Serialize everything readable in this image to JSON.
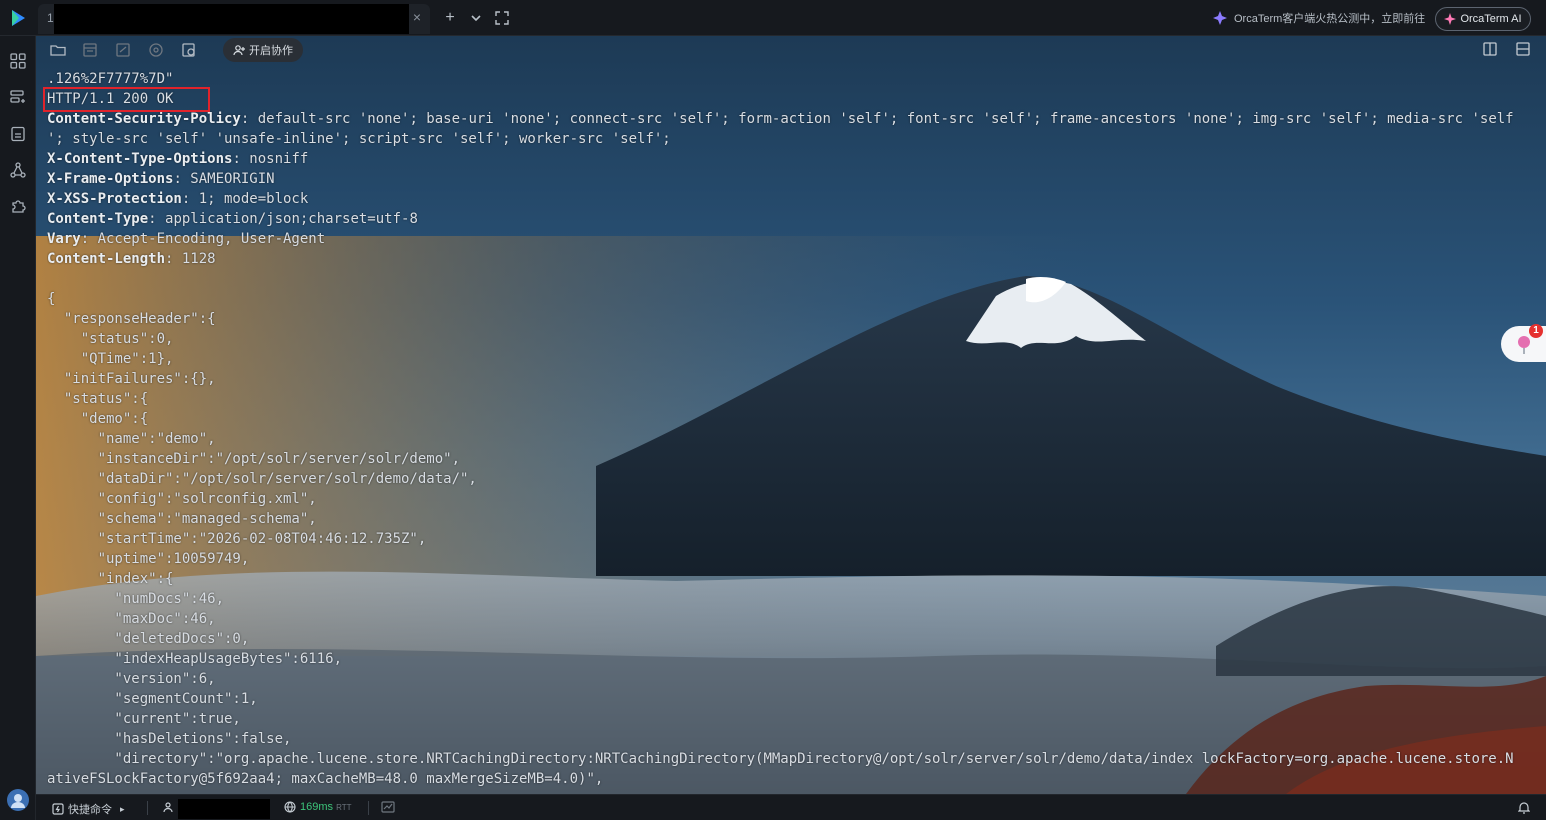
{
  "tabbar": {
    "tab_index": "1",
    "tab_close": "×",
    "new_tab": "+",
    "dropdown": "⌄",
    "fullscreen": "⛶",
    "promo_text": "OrcaTerm客户端火热公测中，立即前往",
    "ai_button": "OrcaTerm AI"
  },
  "toolbar": {
    "collab_label": "开启协作"
  },
  "terminal_lines": [
    ".126%2F7777%7D\"",
    "HTTP/1.1 200 OK",
    "Content-Security-Policy: default-src 'none'; base-uri 'none'; connect-src 'self'; form-action 'self'; font-src 'self'; frame-ancestors 'none'; img-src 'self'; media-src 'self",
    "'; style-src 'self' 'unsafe-inline'; script-src 'self'; worker-src 'self';",
    "X-Content-Type-Options: nosniff",
    "X-Frame-Options: SAMEORIGIN",
    "X-XSS-Protection: 1; mode=block",
    "Content-Type: application/json;charset=utf-8",
    "Vary: Accept-Encoding, User-Agent",
    "Content-Length: 1128",
    "",
    "{",
    "  \"responseHeader\":{",
    "    \"status\":0,",
    "    \"QTime\":1},",
    "  \"initFailures\":{},",
    "  \"status\":{",
    "    \"demo\":{",
    "      \"name\":\"demo\",",
    "      \"instanceDir\":\"/opt/solr/server/solr/demo\",",
    "      \"dataDir\":\"/opt/solr/server/solr/demo/data/\",",
    "      \"config\":\"solrconfig.xml\",",
    "      \"schema\":\"managed-schema\",",
    "      \"startTime\":\"2026-02-08T04:46:12.735Z\",",
    "      \"uptime\":10059749,",
    "      \"index\":{",
    "        \"numDocs\":46,",
    "        \"maxDoc\":46,",
    "        \"deletedDocs\":0,",
    "        \"indexHeapUsageBytes\":6116,",
    "        \"version\":6,",
    "        \"segmentCount\":1,",
    "        \"current\":true,",
    "        \"hasDeletions\":false,",
    "        \"directory\":\"org.apache.lucene.store.NRTCachingDirectory:NRTCachingDirectory(MMapDirectory@/opt/solr/server/solr/demo/data/index lockFactory=org.apache.lucene.store.N",
    "ativeFSLockFactory@5f692aa4; maxCacheMB=48.0 maxMergeSizeMB=4.0)\","
  ],
  "header_keys": [
    "Content-Security-Policy",
    "X-Content-Type-Options",
    "X-Frame-Options",
    "X-XSS-Protection",
    "Content-Type",
    "Vary",
    "Content-Length"
  ],
  "floating_widget": {
    "badge_count": "1"
  },
  "statusbar": {
    "quick_commands": "快捷命令",
    "quick_arrow": "▸",
    "latency": "169ms",
    "latency_unit": "RTT"
  },
  "colors": {
    "highlight_border": "#e1232b",
    "latency_green": "#3cc47a",
    "accent_blue": "#2f8cff"
  }
}
